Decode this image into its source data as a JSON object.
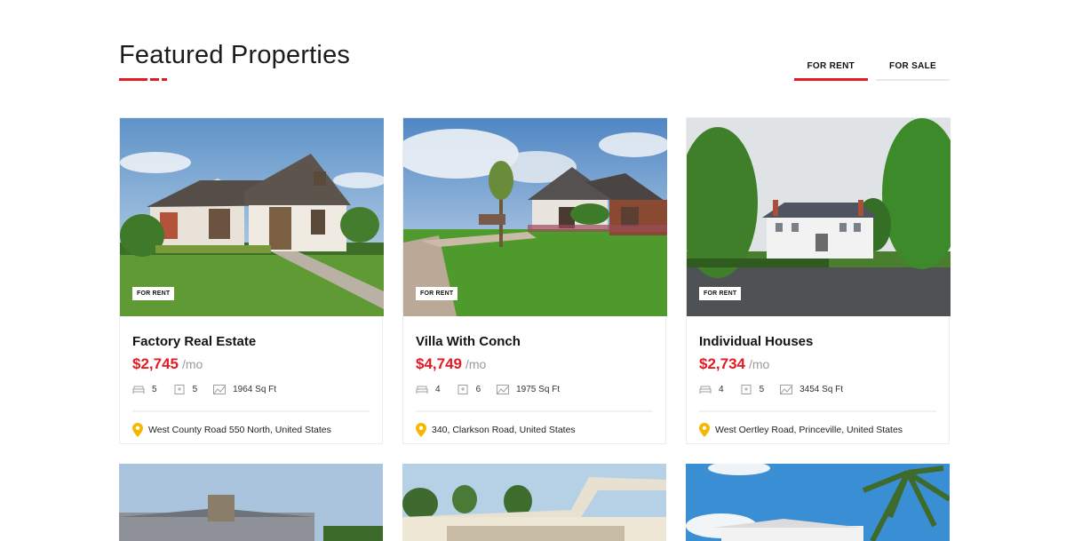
{
  "section": {
    "title": "Featured Properties",
    "tabs": [
      {
        "label": "FOR RENT",
        "active": true
      },
      {
        "label": "FOR SALE",
        "active": false
      }
    ]
  },
  "colors": {
    "accent": "#e21b22",
    "pin": "#f5b800"
  },
  "cards": [
    {
      "badge": "FOR RENT",
      "title": "Factory Real Estate",
      "price": "$2,745",
      "per": "/mo",
      "beds": "5",
      "baths": "5",
      "area": "1964 Sq Ft",
      "address": "West County Road 550 North, United States"
    },
    {
      "badge": "FOR RENT",
      "title": "Villa With Conch",
      "price": "$4,749",
      "per": "/mo",
      "beds": "4",
      "baths": "6",
      "area": "1975 Sq Ft",
      "address": "340, Clarkson Road, United States"
    },
    {
      "badge": "FOR RENT",
      "title": "Individual Houses",
      "price": "$2,734",
      "per": "/mo",
      "beds": "4",
      "baths": "5",
      "area": "3454 Sq Ft",
      "address": "West Oertley Road, Princeville, United States"
    }
  ],
  "icons": {
    "bed": "bed-icon",
    "bath": "bath-icon",
    "area": "area-icon",
    "location": "location-pin-icon"
  }
}
